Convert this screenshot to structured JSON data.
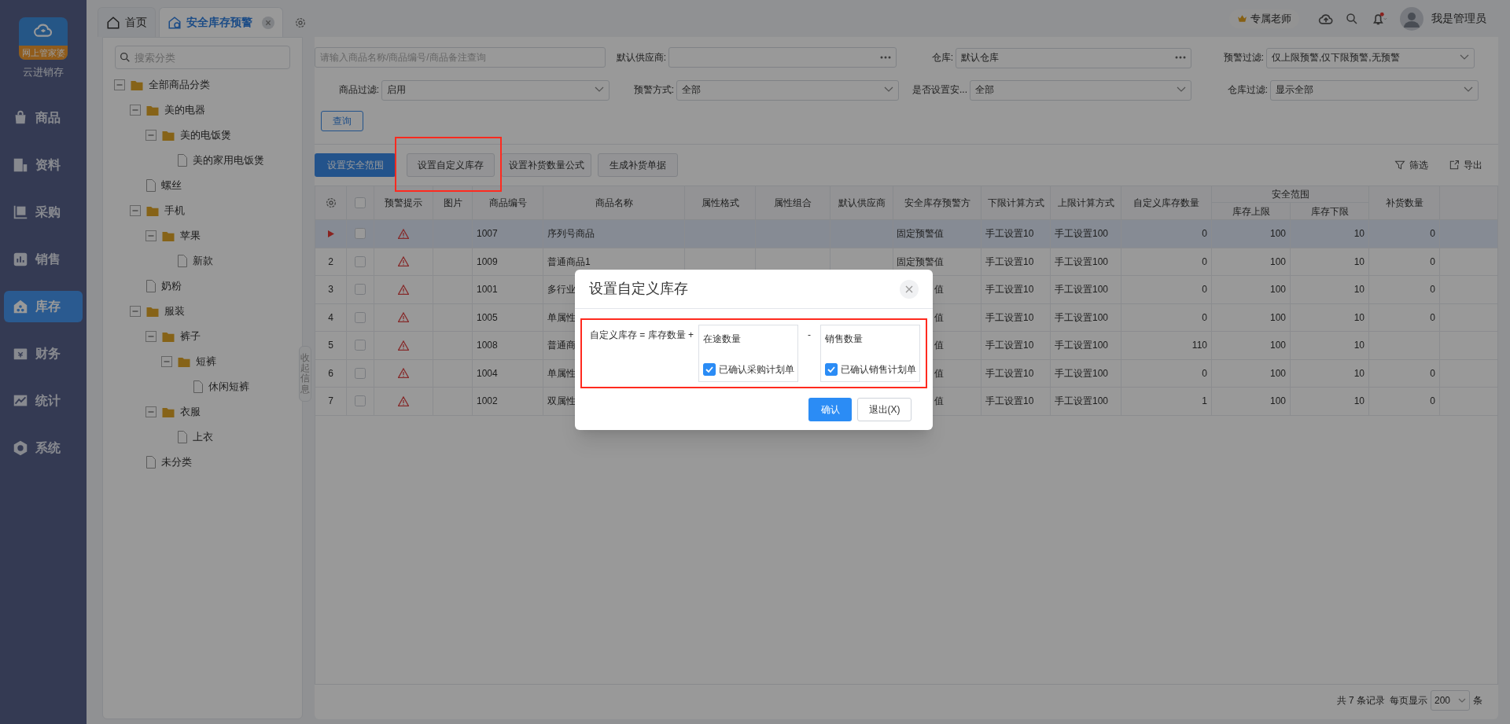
{
  "app": {
    "name": "云进销存",
    "logo_caption": "网上管家婆"
  },
  "nav": [
    {
      "label": "商品",
      "selected": false
    },
    {
      "label": "资料",
      "selected": false
    },
    {
      "label": "采购",
      "selected": false
    },
    {
      "label": "销售",
      "selected": false
    },
    {
      "label": "库存",
      "selected": true
    },
    {
      "label": "财务",
      "selected": false
    },
    {
      "label": "统计",
      "selected": false
    },
    {
      "label": "系统",
      "selected": false
    }
  ],
  "tabs": [
    {
      "label": "首页",
      "selected": false,
      "closable": false
    },
    {
      "label": "安全库存预警",
      "selected": true,
      "closable": true
    }
  ],
  "header": {
    "badge": "专属老师",
    "user": "我是管理员",
    "notification": true
  },
  "tree": {
    "search_placeholder": "搜索分类",
    "collapse_label": "收起信息",
    "items": [
      {
        "label": "全部商品分类",
        "kind": "folder",
        "expanded": true,
        "children": [
          {
            "label": "美的电器",
            "kind": "folder",
            "expanded": true,
            "children": [
              {
                "label": "美的电饭煲",
                "kind": "folder",
                "expanded": true,
                "children": [
                  {
                    "label": "美的家用电饭煲",
                    "kind": "file"
                  }
                ]
              }
            ]
          },
          {
            "label": "螺丝",
            "kind": "file"
          },
          {
            "label": "手机",
            "kind": "folder",
            "expanded": true,
            "children": [
              {
                "label": "苹果",
                "kind": "folder",
                "expanded": true,
                "children": [
                  {
                    "label": "新款",
                    "kind": "file"
                  }
                ]
              }
            ]
          },
          {
            "label": "奶粉",
            "kind": "file"
          },
          {
            "label": "服装",
            "kind": "folder",
            "expanded": true,
            "children": [
              {
                "label": "裤子",
                "kind": "folder",
                "expanded": true,
                "children": [
                  {
                    "label": "短裤",
                    "kind": "folder",
                    "expanded": true,
                    "children": [
                      {
                        "label": "休闲短裤",
                        "kind": "file"
                      }
                    ]
                  }
                ]
              },
              {
                "label": "衣服",
                "kind": "folder",
                "expanded": true,
                "children": [
                  {
                    "label": "上衣",
                    "kind": "file"
                  }
                ]
              }
            ]
          },
          {
            "label": "未分类",
            "kind": "file"
          }
        ]
      }
    ]
  },
  "filter_rows": [
    {
      "fields": [
        {
          "kind": "search",
          "placeholder": "请输入商品名称/商品编号/商品备注查询"
        },
        {
          "kind": "picker",
          "label": "默认供应商:"
        },
        {
          "kind": "picker",
          "label": "仓库:",
          "value": "默认仓库"
        },
        {
          "kind": "select",
          "label": "预警过滤:",
          "value": "仅上限预警,仅下限预警,无预警"
        }
      ]
    },
    {
      "fields": [
        {
          "kind": "select",
          "label": "商品过滤:",
          "value": "启用"
        },
        {
          "kind": "select",
          "label": "预警方式:",
          "value": "全部"
        },
        {
          "kind": "select",
          "label": "是否设置安...",
          "value": "全部"
        },
        {
          "kind": "select",
          "label": "仓库过滤:",
          "value": "显示全部"
        }
      ]
    }
  ],
  "query_button": "查询",
  "toolbar": {
    "buttons": [
      {
        "label": "设置安全范围",
        "primary": true,
        "highlighted": false
      },
      {
        "label": "设置自定义库存",
        "primary": false,
        "highlighted": true
      },
      {
        "label": "设置补货数量公式",
        "primary": false,
        "highlighted": false
      },
      {
        "label": "生成补货单据",
        "primary": false,
        "highlighted": false
      }
    ],
    "actions": [
      {
        "label": "筛选"
      },
      {
        "label": "导出"
      }
    ]
  },
  "table": {
    "group_header": "安全范围",
    "all_checked": false,
    "columns": [
      {
        "label": "预警提示"
      },
      {
        "label": "图片"
      },
      {
        "label": "商品编号"
      },
      {
        "label": "商品名称"
      },
      {
        "label": "属性格式"
      },
      {
        "label": "属性组合"
      },
      {
        "label": "默认供应商"
      },
      {
        "label": "安全库存预警方"
      },
      {
        "label": "下限计算方式"
      },
      {
        "label": "上限计算方式"
      },
      {
        "label": "自定义库存数量"
      },
      {
        "label": "库存上限"
      },
      {
        "label": "库存下限"
      },
      {
        "label": "补货数量"
      }
    ],
    "rows": [
      {
        "selected": true,
        "checked": false,
        "code": "1007",
        "name": "序列号商品",
        "warn_mode": "固定预警值",
        "lower_mode": "手工设置10",
        "upper_mode": "手工设置100",
        "custom_qty": "0",
        "upper": "100",
        "lower": "10",
        "reorder": "0"
      },
      {
        "selected": false,
        "checked": false,
        "index": "2",
        "code": "1009",
        "name": "普通商品1",
        "warn_mode": "固定预警值",
        "lower_mode": "手工设置10",
        "upper_mode": "手工设置100",
        "custom_qty": "0",
        "upper": "100",
        "lower": "10",
        "reorder": "0"
      },
      {
        "selected": false,
        "checked": false,
        "index": "3",
        "code": "1001",
        "name": "多行业",
        "warn_mode": "值",
        "lower_mode": "手工设置10",
        "upper_mode": "手工设置100",
        "custom_qty": "0",
        "upper": "100",
        "lower": "10",
        "reorder": "0"
      },
      {
        "selected": false,
        "checked": false,
        "index": "4",
        "code": "1005",
        "name": "单属性",
        "warn_mode": "值",
        "lower_mode": "手工设置10",
        "upper_mode": "手工设置100",
        "custom_qty": "0",
        "upper": "100",
        "lower": "10",
        "reorder": "0"
      },
      {
        "selected": false,
        "checked": false,
        "index": "5",
        "code": "1008",
        "name": "普通商",
        "warn_mode": "值",
        "lower_mode": "手工设置10",
        "upper_mode": "手工设置100",
        "custom_qty": "110",
        "upper": "100",
        "lower": "10"
      },
      {
        "selected": false,
        "checked": false,
        "index": "6",
        "code": "1004",
        "name": "单属性",
        "warn_mode": "值",
        "lower_mode": "手工设置10",
        "upper_mode": "手工设置100",
        "custom_qty": "0",
        "upper": "100",
        "lower": "10",
        "reorder": "0"
      },
      {
        "selected": false,
        "checked": false,
        "index": "7",
        "code": "1002",
        "name": "双属性",
        "warn_mode": "值",
        "lower_mode": "手工设置10",
        "upper_mode": "手工设置100",
        "custom_qty": "1",
        "upper": "100",
        "lower": "10",
        "reorder": "0"
      }
    ]
  },
  "footer": {
    "summary": "共 7 条记录",
    "per_page_label": "每页显示",
    "per_page": "200",
    "unit": "条"
  },
  "modal": {
    "title": "设置自定义库存",
    "highlighted": true,
    "formula": "自定义库存 = 库存数量 +",
    "operator": "-",
    "boxes": [
      {
        "title": "在途数量",
        "option": "已确认采购计划单",
        "checked": true
      },
      {
        "title": "销售数量",
        "option": "已确认销售计划单",
        "checked": true
      }
    ],
    "buttons": [
      {
        "label": "确认",
        "primary": true
      },
      {
        "label": "退出(X)",
        "primary": false
      }
    ]
  }
}
